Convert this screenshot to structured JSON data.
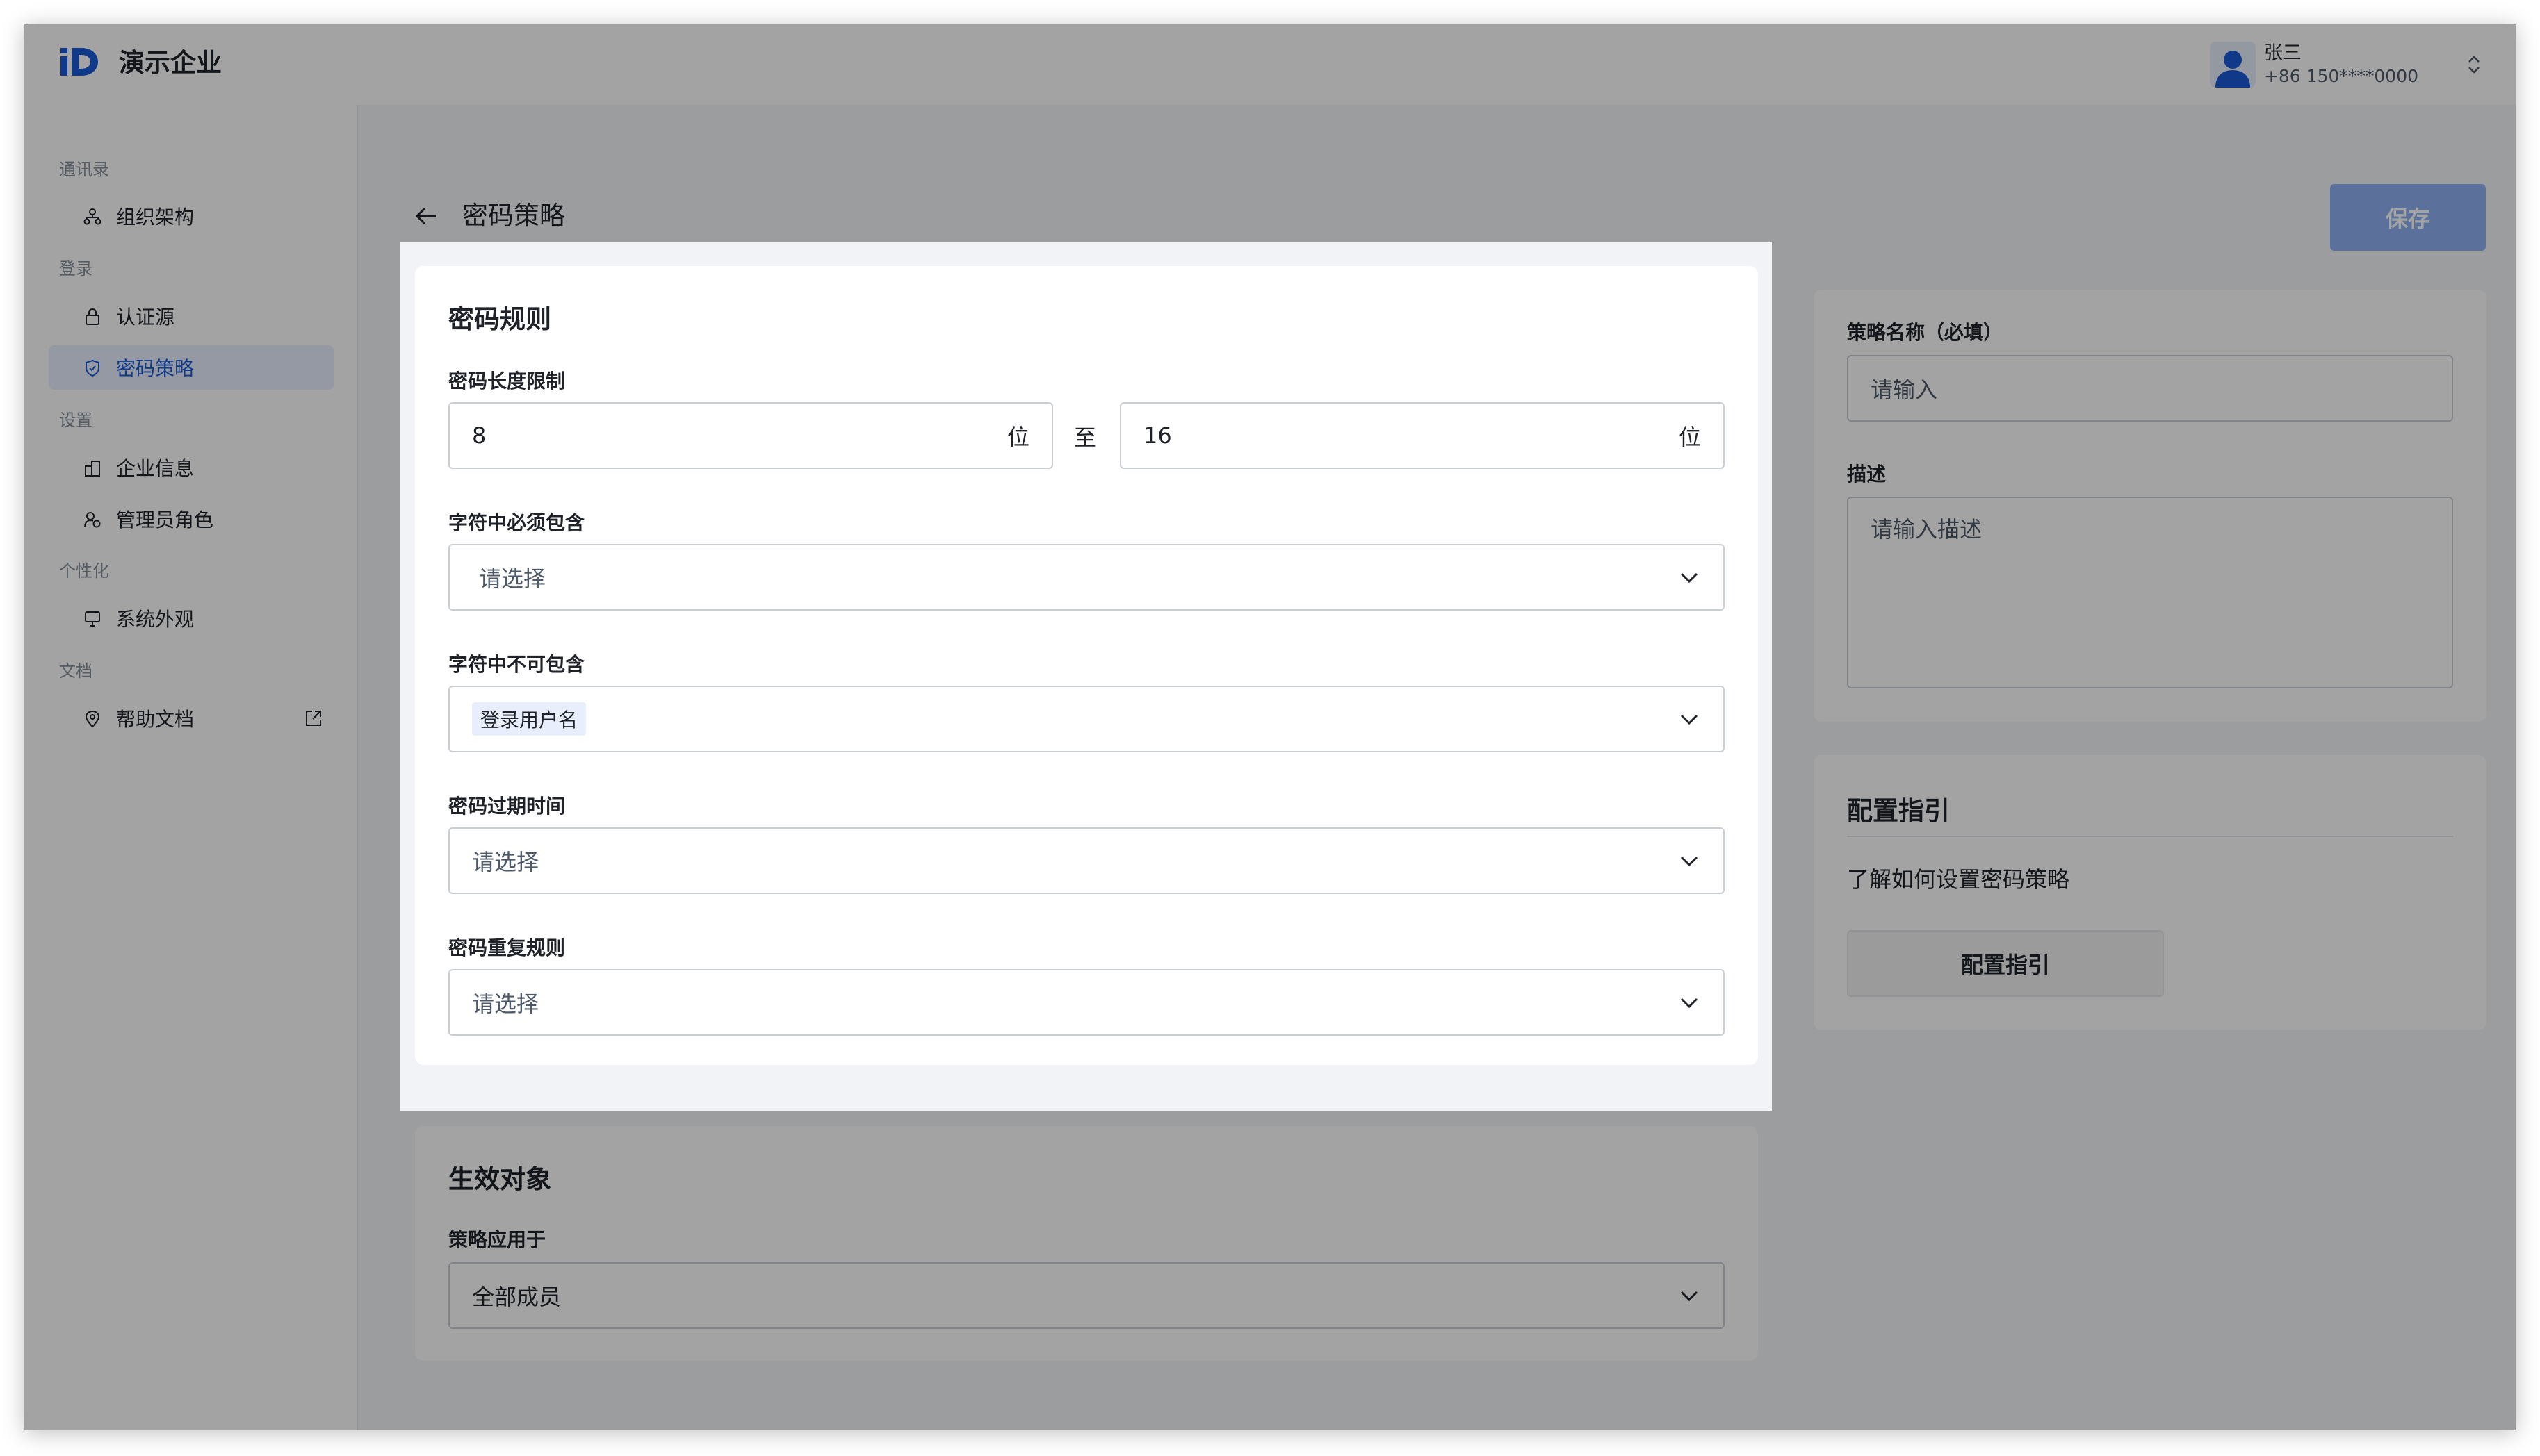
{
  "app": {
    "title": "演示企业"
  },
  "user": {
    "name": "张三",
    "phone": "+86 150****0000"
  },
  "sidebar": {
    "groups": [
      {
        "label": "通讯录"
      },
      {
        "label": "登录"
      },
      {
        "label": "设置"
      },
      {
        "label": "个性化"
      },
      {
        "label": "文档"
      }
    ],
    "items": [
      {
        "label": "组织架构",
        "icon": "org-chart-icon"
      },
      {
        "label": "认证源",
        "icon": "lock-icon"
      },
      {
        "label": "密码策略",
        "icon": "shield-icon",
        "active": true
      },
      {
        "label": "企业信息",
        "icon": "building-icon"
      },
      {
        "label": "管理员角色",
        "icon": "admin-user-icon"
      },
      {
        "label": "系统外观",
        "icon": "monitor-icon"
      },
      {
        "label": "帮助文档",
        "icon": "help-doc-icon",
        "external": true
      }
    ]
  },
  "page": {
    "title": "密码策略",
    "save_label": "保存"
  },
  "rules": {
    "title": "密码规则",
    "length_label": "密码长度限制",
    "min_value": "8",
    "max_value": "16",
    "unit": "位",
    "to": "至",
    "must_include_label": "字符中必须包含",
    "must_include_placeholder": "请选择",
    "must_exclude_label": "字符中不可包含",
    "must_exclude_tag": "登录用户名",
    "expire_label": "密码过期时间",
    "expire_placeholder": "请选择",
    "repeat_label": "密码重复规则",
    "repeat_placeholder": "请选择"
  },
  "target": {
    "title": "生效对象",
    "apply_label": "策略应用于",
    "apply_value": "全部成员"
  },
  "policy": {
    "name_label": "策略名称（必填）",
    "name_placeholder": "请输入",
    "desc_label": "描述",
    "desc_placeholder": "请输入描述"
  },
  "guide": {
    "title": "配置指引",
    "text": "了解如何设置密码策略",
    "button": "配置指引"
  },
  "colors": {
    "accent": "#1a5bd6",
    "save_button": "#8fb0f2",
    "overlay": "rgba(0,0,0,0.36)"
  }
}
